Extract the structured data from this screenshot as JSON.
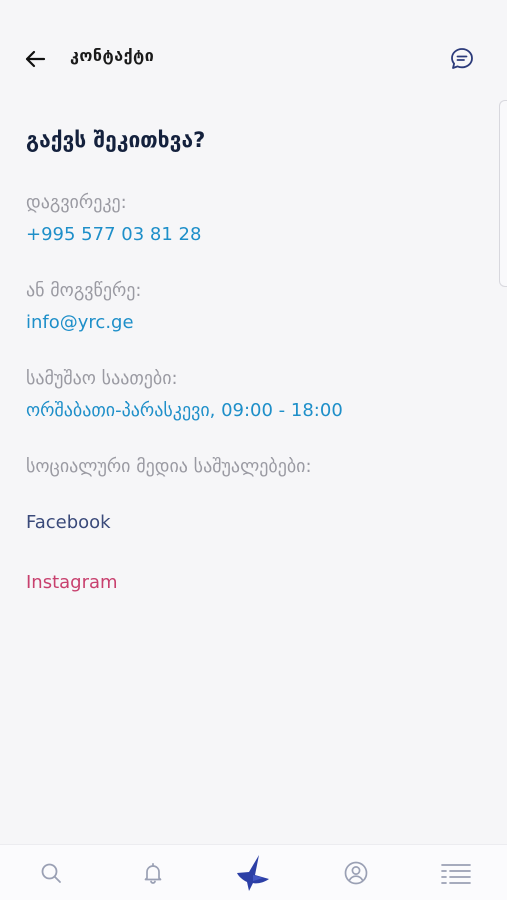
{
  "header": {
    "title": "კონტაქტი",
    "back_icon": "arrow-left-icon",
    "chat_icon": "chat-bubble-icon"
  },
  "contact": {
    "question": "გაქვს შეკითხვა?",
    "call_label": "დაგვირეკე:",
    "phone": "+995 577 03 81 28",
    "write_label": "ან მოგვწერე:",
    "email": "info@yrc.ge",
    "hours_label": "სამუშაო საათები:",
    "hours": "ორშაბათი-პარასკევი, 09:00 - 18:00",
    "social_label": "სოციალური მედია საშუალებები:"
  },
  "social": {
    "facebook": "Facebook",
    "instagram": "Instagram"
  },
  "colors": {
    "link": "#1e8fc9",
    "facebook": "#3a4a7a",
    "instagram": "#c8406e",
    "brand": "#2c3fa6"
  },
  "bottom_nav": [
    {
      "icon": "search-icon"
    },
    {
      "icon": "bell-icon"
    },
    {
      "icon": "logo-icon"
    },
    {
      "icon": "user-icon"
    },
    {
      "icon": "menu-icon"
    }
  ]
}
